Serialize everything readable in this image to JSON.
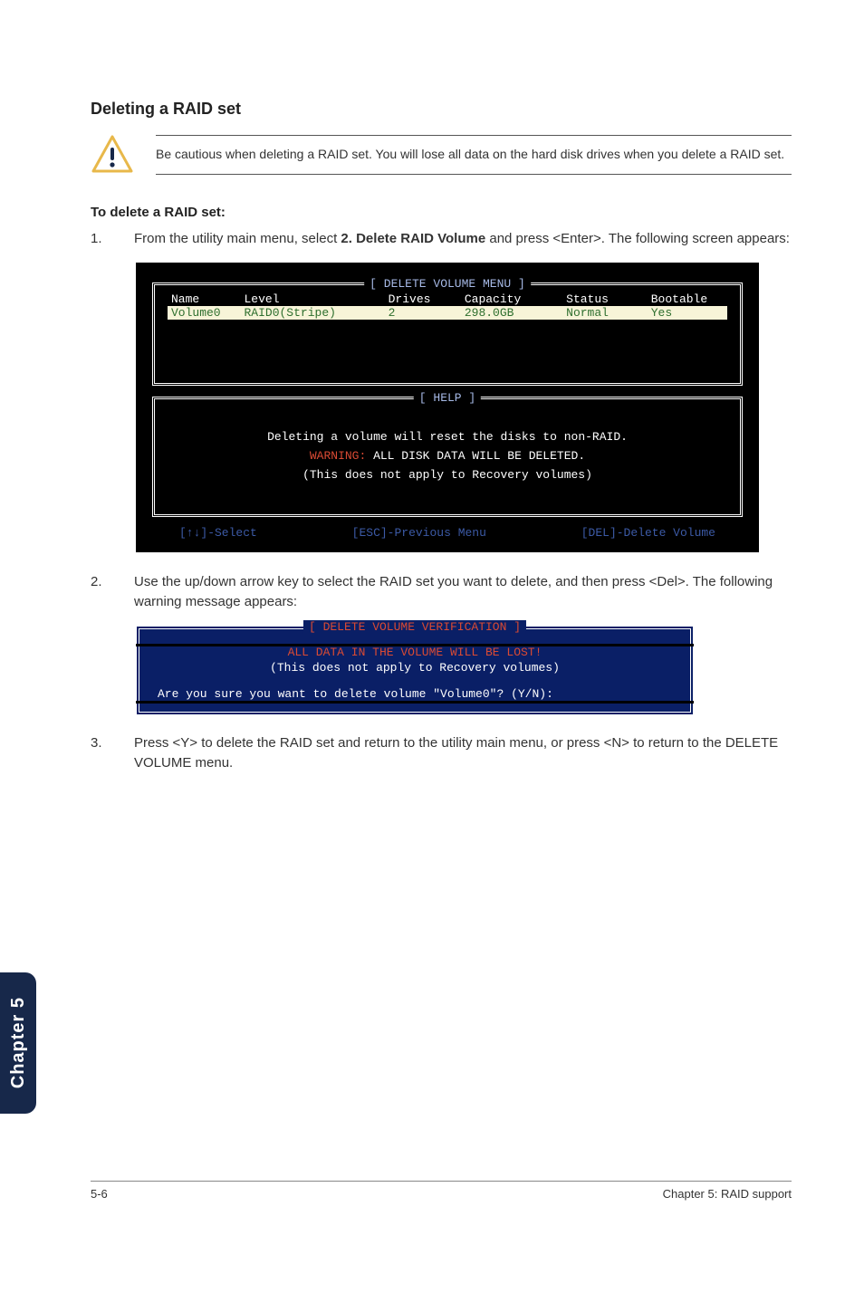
{
  "section_title": "Deleting a RAID set",
  "caution_text": "Be cautious when deleting a RAID set. You will lose all data on the hard disk drives when you delete a RAID set.",
  "subtitle": "To delete a RAID set:",
  "steps": {
    "s1_num": "1.",
    "s1_a": "From the utility main menu, select ",
    "s1_bold": "2. Delete RAID Volume",
    "s1_b": " and press <Enter>. The following screen appears:",
    "s2_num": "2.",
    "s2_text": "Use the up/down arrow key to select the RAID set you want to delete, and then press <Del>. The following warning message appears:",
    "s3_num": "3.",
    "s3_text": "Press <Y> to delete the RAID set and return to the utility main menu, or press <N> to return to the DELETE VOLUME menu."
  },
  "terminal": {
    "menu_legend": "[ DELETE VOLUME MENU ]",
    "headers": {
      "name": "Name",
      "level": "Level",
      "drives": "Drives",
      "capacity": "Capacity",
      "status": "Status",
      "bootable": "Bootable"
    },
    "row": {
      "name": "Volume0",
      "level": "RAID0(Stripe)",
      "drives": "2",
      "capacity": "298.0GB",
      "status": "Normal",
      "bootable": "Yes"
    },
    "help_legend": "[ HELP ]",
    "help_l1": "Deleting a volume will reset the disks to non-RAID.",
    "help_warn_prefix": "WARNING: ",
    "help_warn_rest": "ALL DISK DATA WILL BE DELETED.",
    "help_l3": "(This does not apply to Recovery volumes)",
    "footer_select": "[↑↓]-Select",
    "footer_prev": "[ESC]-Previous Menu",
    "footer_del": "[DEL]-Delete Volume"
  },
  "dialog": {
    "legend": "[ DELETE VOLUME VERIFICATION ]",
    "line_red": "ALL DATA IN THE VOLUME WILL BE LOST!",
    "line2": "(This does not apply to Recovery volumes)",
    "prompt": "Are you sure you want to delete volume \"Volume0\"? (Y/N):"
  },
  "side_tab": "Chapter 5",
  "footer_left": "5-6",
  "footer_right": "Chapter 5: RAID support"
}
